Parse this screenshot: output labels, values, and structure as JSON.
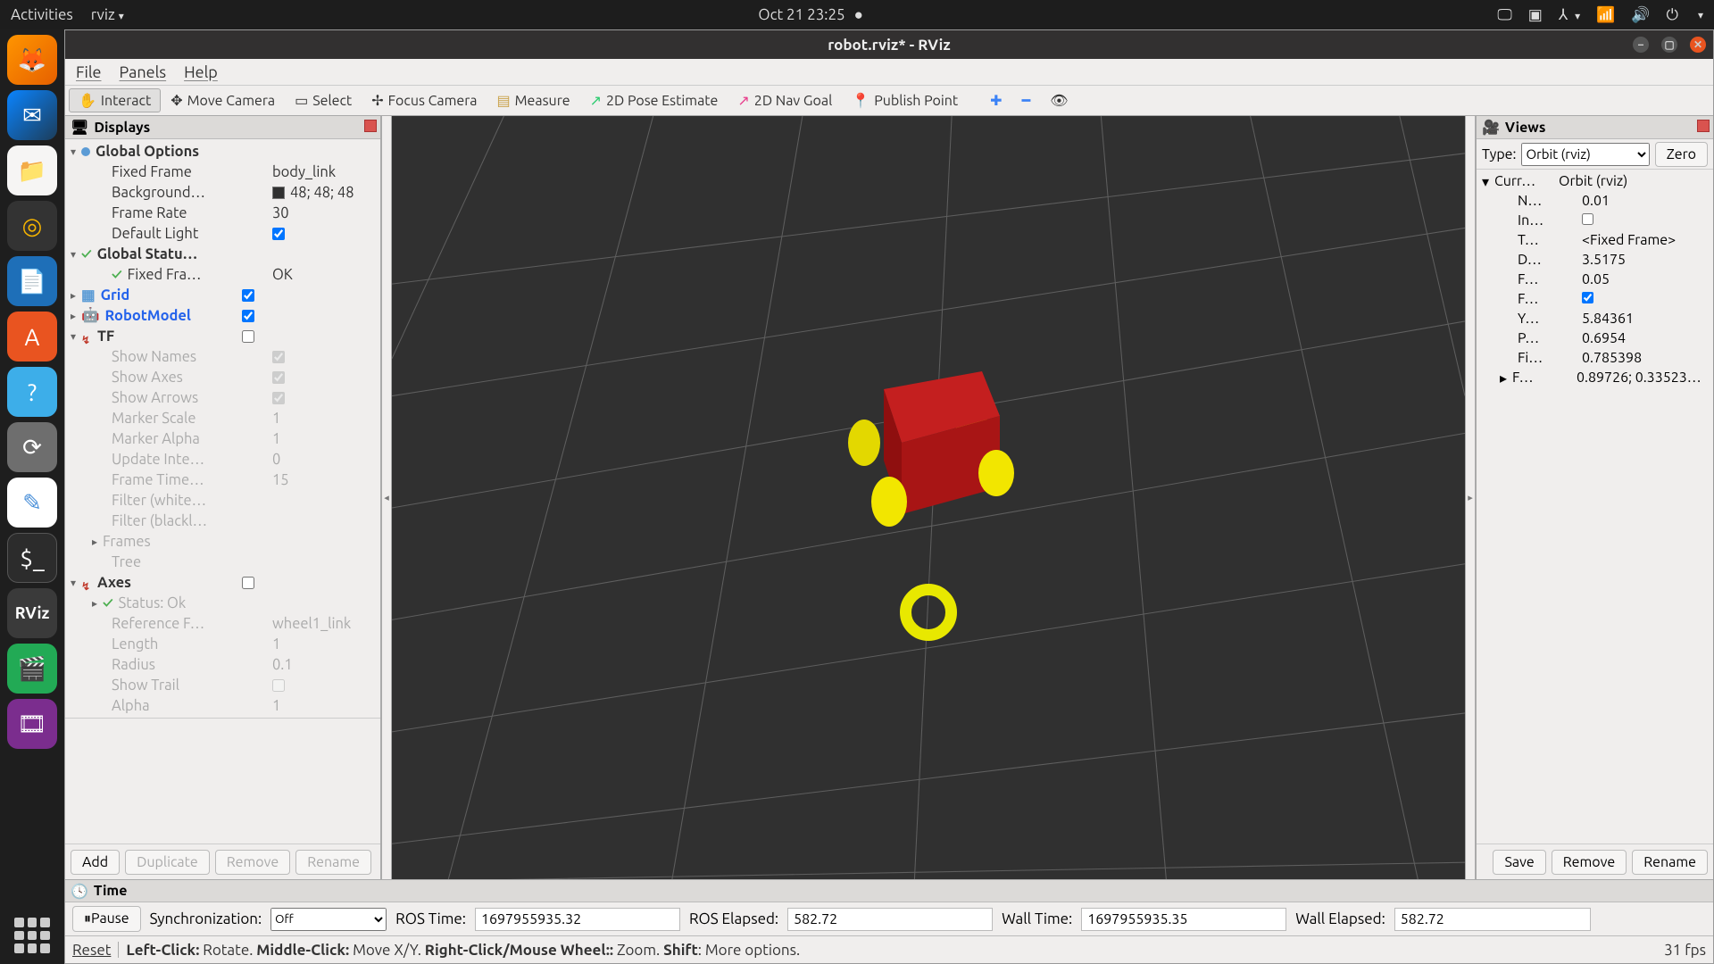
{
  "gnome": {
    "activities": "Activities",
    "appmenu": "rviz",
    "clock": "Oct 21  23:25"
  },
  "window": {
    "title": "robot.rviz* - RViz"
  },
  "menubar": {
    "file": "File",
    "panels": "Panels",
    "help": "Help"
  },
  "toolbar": {
    "interact": "Interact",
    "move_camera": "Move Camera",
    "select": "Select",
    "focus_camera": "Focus Camera",
    "measure": "Measure",
    "pose_estimate": "2D Pose Estimate",
    "nav_goal": "2D Nav Goal",
    "publish_point": "Publish Point"
  },
  "displays": {
    "title": "Displays",
    "global_options": "Global Options",
    "fixed_frame": {
      "label": "Fixed Frame",
      "value": "body_link"
    },
    "background": {
      "label": "Background…",
      "value": "48; 48; 48"
    },
    "frame_rate": {
      "label": "Frame Rate",
      "value": "30"
    },
    "default_light": {
      "label": "Default Light"
    },
    "global_status": "Global Statu…",
    "fixed_fra_ok": {
      "label": "Fixed Fra…",
      "value": "OK"
    },
    "grid": "Grid",
    "robot_model": "RobotModel",
    "tf": "TF",
    "show_names": "Show Names",
    "show_axes": "Show Axes",
    "show_arrows": "Show Arrows",
    "marker_scale": {
      "label": "Marker Scale",
      "value": "1"
    },
    "marker_alpha": {
      "label": "Marker Alpha",
      "value": "1"
    },
    "update_int": {
      "label": "Update Inte…",
      "value": "0"
    },
    "frame_time": {
      "label": "Frame Time…",
      "value": "15"
    },
    "filter_white": "Filter (white…",
    "filter_black": "Filter (blackl…",
    "frames": "Frames",
    "tree_item": "Tree",
    "axes": "Axes",
    "status_ok": "Status: Ok",
    "reference_f": {
      "label": "Reference F…",
      "value": "wheel1_link"
    },
    "length": {
      "label": "Length",
      "value": "1"
    },
    "radius": {
      "label": "Radius",
      "value": "0.1"
    },
    "show_trail": "Show Trail",
    "alpha": {
      "label": "Alpha",
      "value": "1"
    },
    "btn_add": "Add",
    "btn_duplicate": "Duplicate",
    "btn_remove": "Remove",
    "btn_rename": "Rename"
  },
  "views": {
    "title": "Views",
    "type_label": "Type:",
    "type_value": "Orbit (rviz)",
    "zero": "Zero",
    "current": {
      "label": "Curr…",
      "value": "Orbit (rviz)"
    },
    "near": {
      "label": "N…",
      "value": "0.01"
    },
    "invert": {
      "label": "In…"
    },
    "target": {
      "label": "T…",
      "value": "<Fixed Frame>"
    },
    "distance": {
      "label": "D…",
      "value": "3.5175"
    },
    "focal_s": {
      "label": "F…",
      "value": "0.05"
    },
    "focal_f": {
      "label": "F…"
    },
    "yaw": {
      "label": "Y…",
      "value": "5.84361"
    },
    "pitch": {
      "label": "P…",
      "value": "0.6954"
    },
    "field": {
      "label": "Fi…",
      "value": "0.785398"
    },
    "focal_p": {
      "label": "F…",
      "value": "0.89726; 0.33523…"
    },
    "btn_save": "Save",
    "btn_remove": "Remove",
    "btn_rename": "Rename"
  },
  "time": {
    "title": "Time",
    "pause": "Pause",
    "sync": "Synchronization:",
    "sync_val": "Off",
    "ros_time": "ROS Time:",
    "ros_time_val": "1697955935.32",
    "ros_elapsed": "ROS Elapsed:",
    "ros_elapsed_val": "582.72",
    "wall_time": "Wall Time:",
    "wall_time_val": "1697955935.35",
    "wall_elapsed": "Wall Elapsed:",
    "wall_elapsed_val": "582.72"
  },
  "status": {
    "reset": "Reset",
    "hint": "Left-Click: Rotate. Middle-Click: Move X/Y. Right-Click/Mouse Wheel:: Zoom. Shift: More options.",
    "fps": "31 fps"
  }
}
